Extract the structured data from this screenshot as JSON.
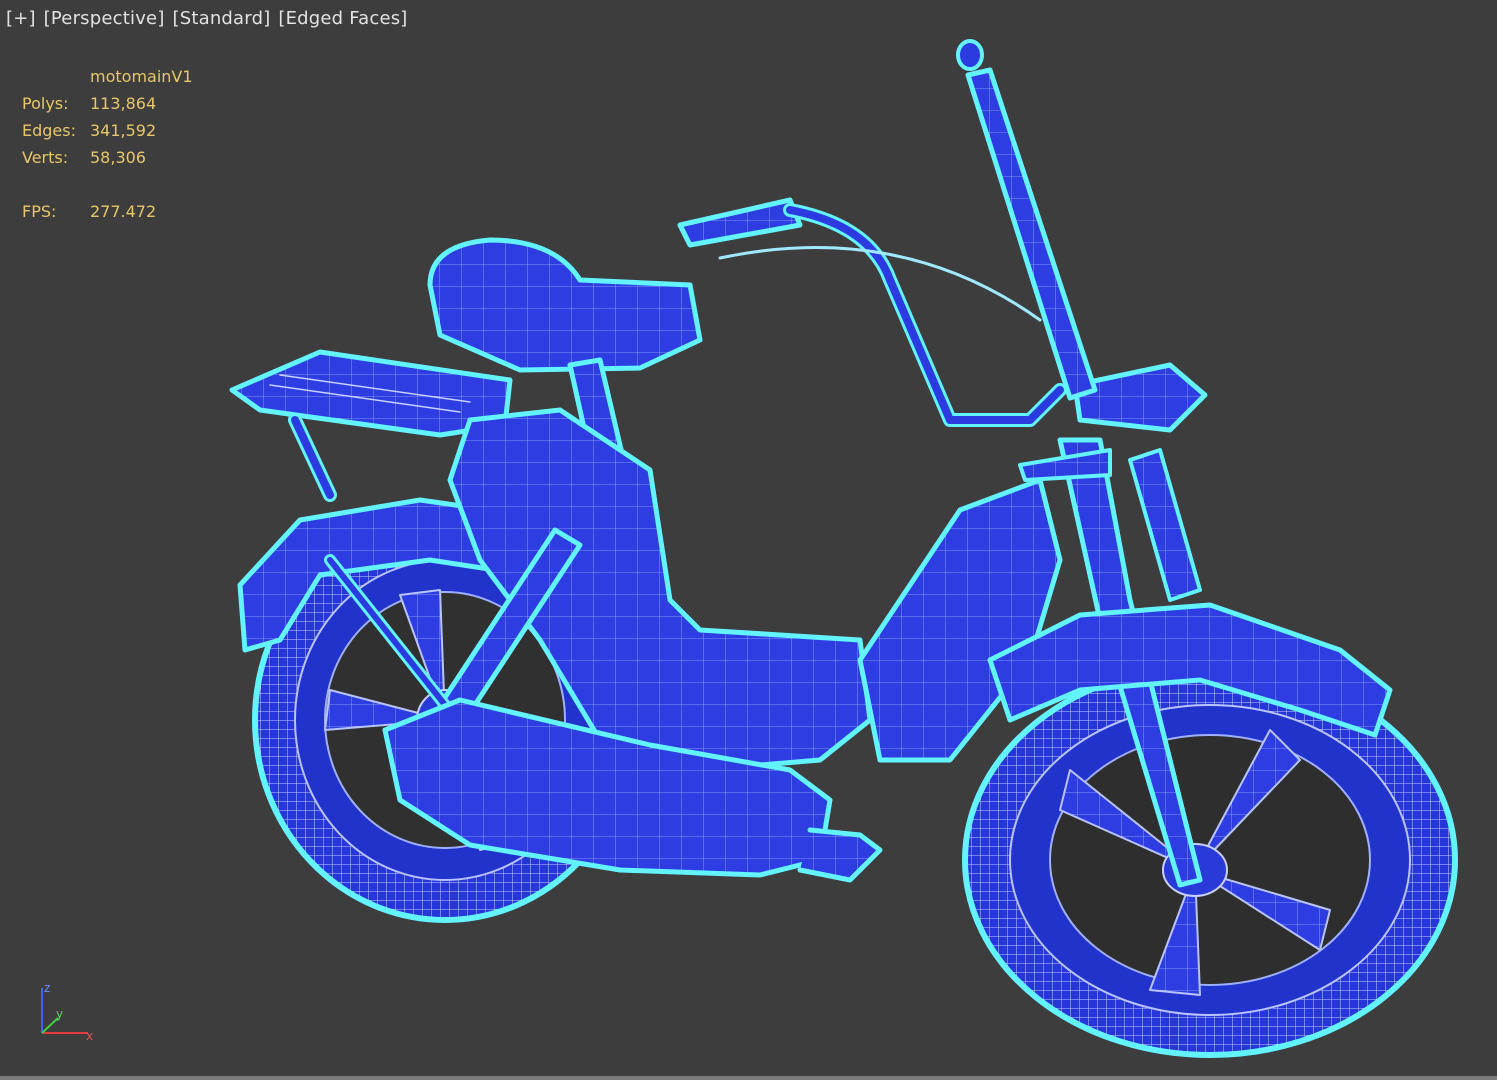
{
  "viewport": {
    "labels": [
      "[+]",
      "[Perspective]",
      "[Standard]",
      "[Edged Faces]"
    ]
  },
  "stats": {
    "object_name": "motomainV1",
    "rows": [
      {
        "label": "Polys:",
        "value": "113,864"
      },
      {
        "label": "Edges:",
        "value": "341,592"
      },
      {
        "label": "Verts:",
        "value": "58,306"
      }
    ],
    "fps_label": "FPS:",
    "fps_value": "277.472"
  },
  "gizmo": {
    "z": "z",
    "y": "y",
    "x": "x"
  },
  "colors": {
    "background": "#3d3d3d",
    "mesh_fill": "#2b3be0",
    "mesh_edge": "#aab8ff",
    "selection_outline": "#5ff5ff",
    "stats_text": "#e8c76a",
    "label_text": "#e2e2e2"
  }
}
